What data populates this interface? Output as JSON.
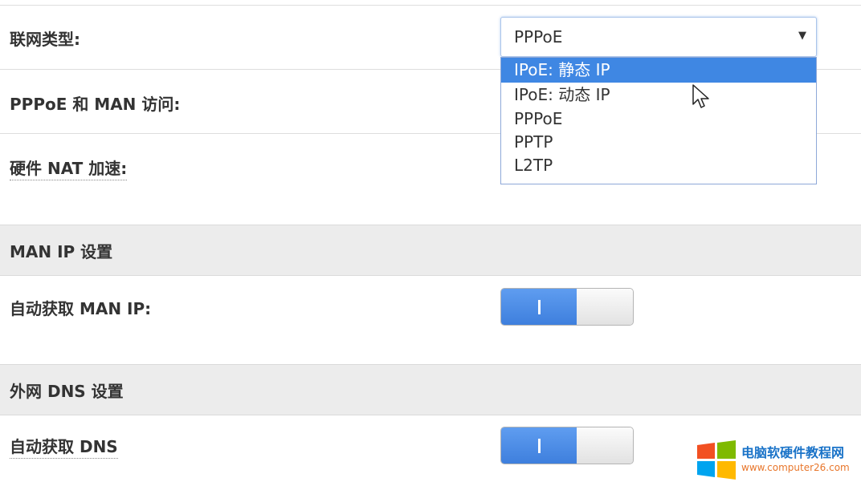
{
  "rows": {
    "wan_type_label": "联网类型:",
    "pppoe_man_label": "PPPoE 和 MAN 访问:",
    "hw_nat_label": "硬件 NAT 加速:",
    "auto_man_ip_label": "自动获取 MAN IP:",
    "auto_dns_label": "自动获取 DNS"
  },
  "sections": {
    "man_ip": "MAN IP 设置",
    "wan_dns": "外网 DNS 设置"
  },
  "select": {
    "value": "PPPoE",
    "arrow": "▼",
    "options": [
      {
        "label": "IPoE: 静态 IP",
        "highlighted": true
      },
      {
        "label": "IPoE: 动态 IP",
        "highlighted": false
      },
      {
        "label": "PPPoE",
        "highlighted": false
      },
      {
        "label": "PPTP",
        "highlighted": false
      },
      {
        "label": "L2TP",
        "highlighted": false
      }
    ]
  },
  "toggles": {
    "auto_man_ip": {
      "state": "on"
    },
    "auto_dns": {
      "state": "on"
    }
  },
  "watermark": {
    "name": "电脑软硬件教程网",
    "url": "www.computer26.com"
  },
  "colors": {
    "highlight": "#3f87e3",
    "section_bg": "#ececec",
    "watermark_blue": "#1a73c8",
    "watermark_orange": "#e8762b"
  }
}
